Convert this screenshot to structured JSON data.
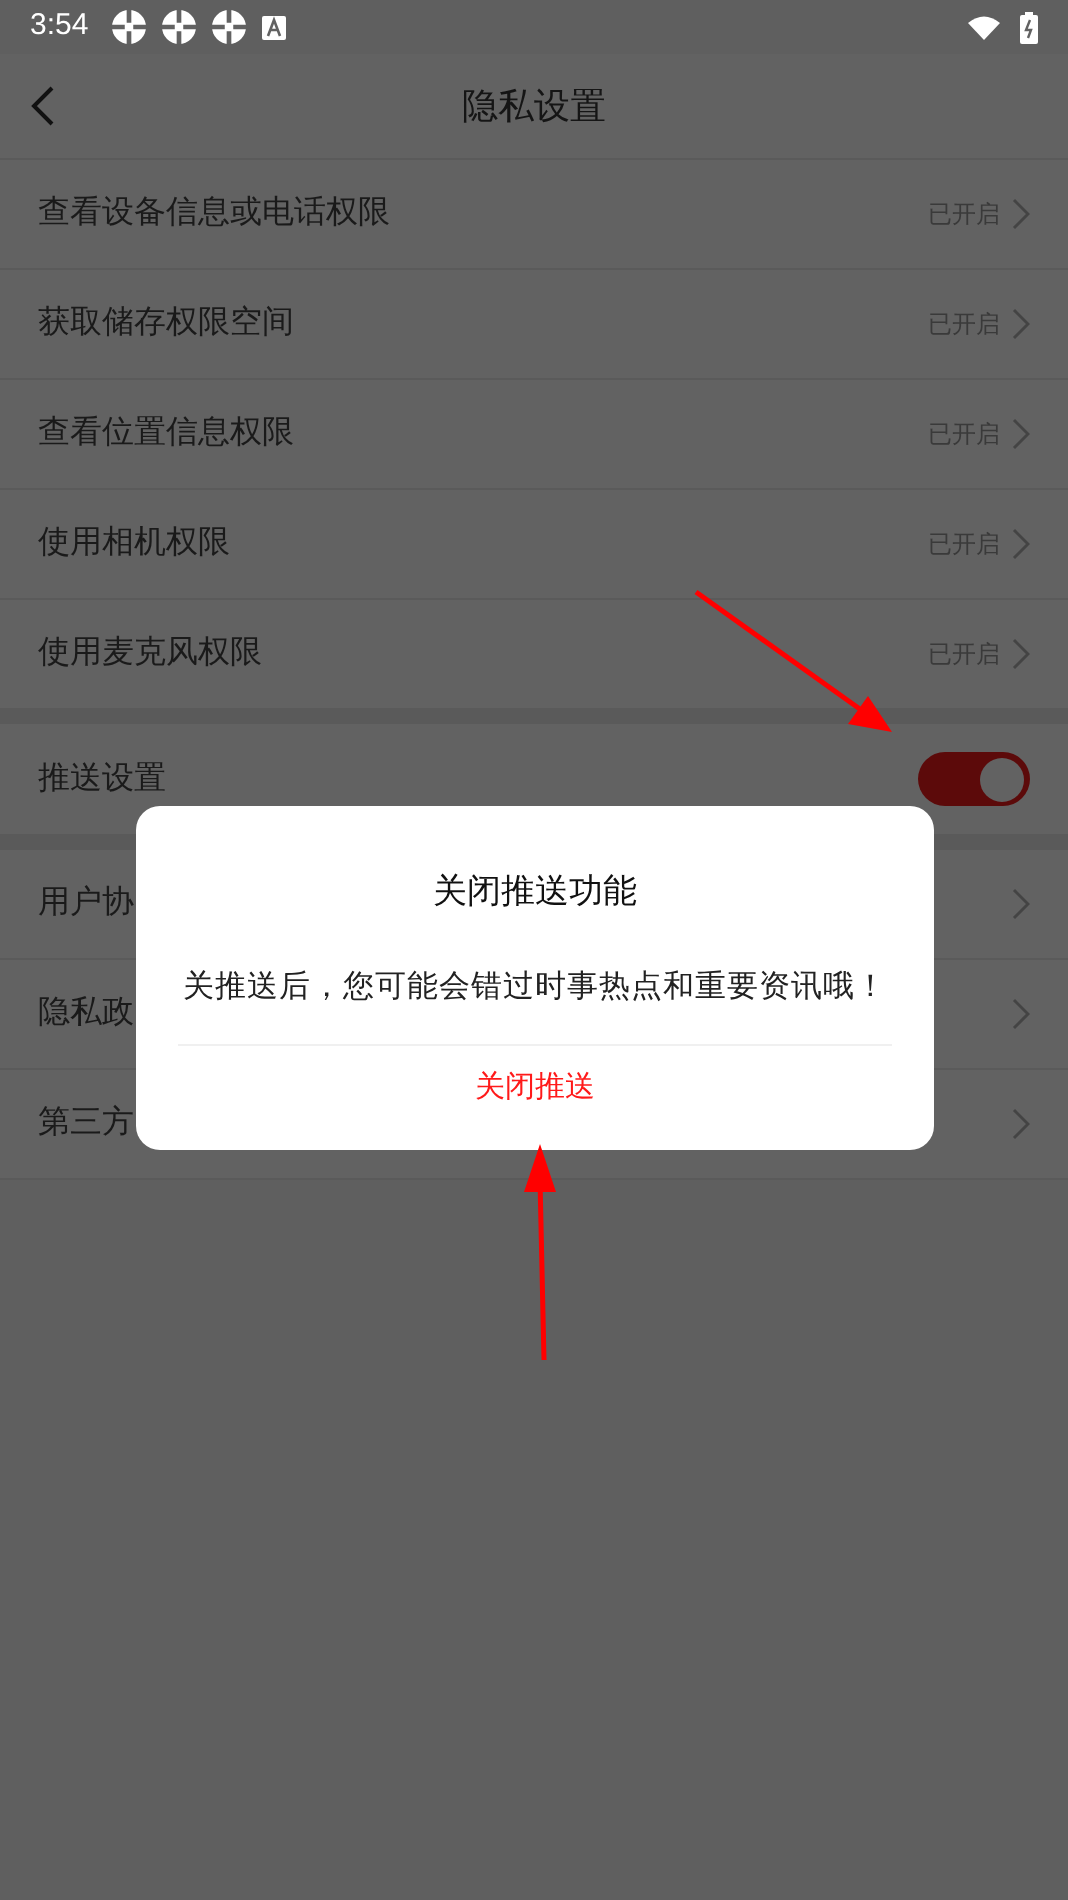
{
  "status_bar": {
    "time": "3:54"
  },
  "header": {
    "title": "隐私设置"
  },
  "permissions": [
    {
      "label": "查看设备信息或电话权限",
      "status": "已开启"
    },
    {
      "label": "获取储存权限空间",
      "status": "已开启"
    },
    {
      "label": "查看位置信息权限",
      "status": "已开启"
    },
    {
      "label": "使用相机权限",
      "status": "已开启"
    },
    {
      "label": "使用麦克风权限",
      "status": "已开启"
    }
  ],
  "push_setting": {
    "label": "推送设置",
    "on": true
  },
  "links": [
    {
      "label": "用户协"
    },
    {
      "label": "隐私政"
    },
    {
      "label": "第三方"
    }
  ],
  "dialog": {
    "title": "关闭推送功能",
    "message": "关推送后，您可能会错过时事热点和重要资讯哦！",
    "button": "关闭推送"
  }
}
